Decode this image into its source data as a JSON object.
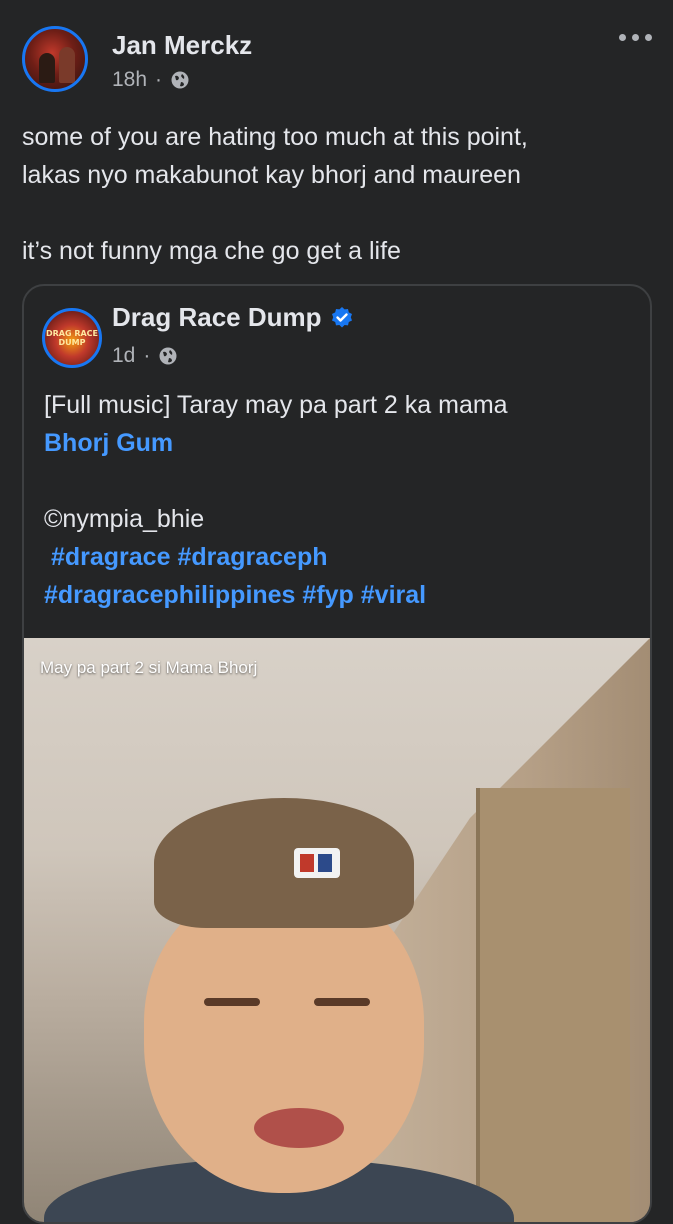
{
  "post": {
    "author": "Jan Merckz",
    "time": "18h",
    "separator": "·",
    "visibility_icon": "globe-icon",
    "more_icon": "more-options-icon",
    "text_line1": "some of you are hating too much at this point,",
    "text_line2": "lakas nyo makabunot kay bhorj and maureen",
    "text_line3": "it’s not funny mga che go get a life"
  },
  "shared": {
    "page_name": "Drag Race Dump",
    "verified_icon": "verified-badge-icon",
    "time": "1d",
    "separator": "·",
    "avatar_text": "DRAG RACE DUMP",
    "text_line1": "[Full music] Taray may pa part 2 ka mama",
    "mention": "Bhorj Gum",
    "credit": "©nympia_bhie",
    "hashtags": [
      "#dragrace",
      "#dragraceph",
      "#dragracephilippines",
      "#fyp",
      "#viral"
    ],
    "media_caption": "May pa part 2 si Mama Bhorj"
  },
  "colors": {
    "background": "#242526",
    "text": "#e4e6eb",
    "secondary": "#b0b3b8",
    "link": "#4599ff",
    "accent": "#1877f2"
  }
}
